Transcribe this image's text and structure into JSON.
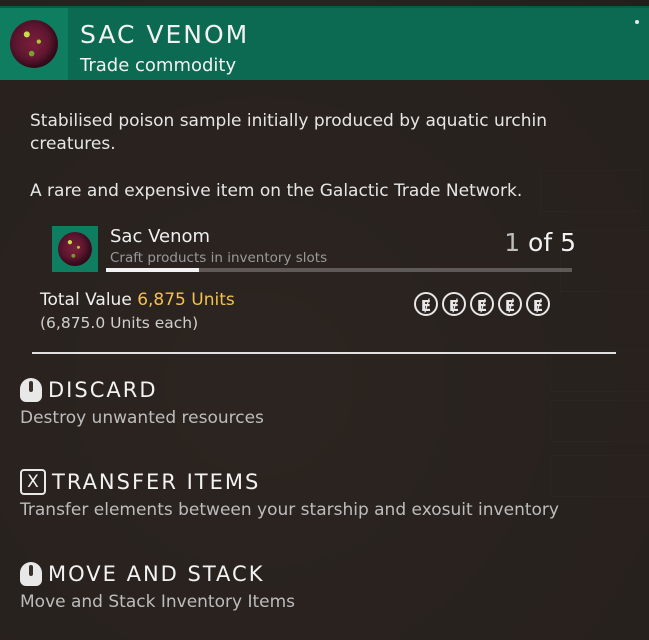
{
  "header": {
    "title": "SAC VENOM",
    "subtitle": "Trade commodity"
  },
  "description": {
    "line1": "Stabilised poison sample initially produced by aquatic urchin creatures.",
    "line2": "A rare and expensive item on the Galactic Trade Network."
  },
  "item": {
    "name": "Sac Venom",
    "hint": "Craft products in inventory slots",
    "count_current": "1",
    "count_of": " of 5",
    "progress_fraction": 0.2
  },
  "value": {
    "label": "Total Value ",
    "amount": "6,875 Units",
    "each": "(6,875.0 Units each)",
    "rarity_symbols": [
      "Ɇ",
      "Ɇ",
      "Ɇ",
      "Ɇ",
      "Ɇ"
    ]
  },
  "actions": [
    {
      "title": "DISCARD",
      "desc": "Destroy unwanted resources",
      "icon": "mouse-icon"
    },
    {
      "title": "TRANSFER ITEMS",
      "desc": "Transfer elements between your starship and exosuit inventory",
      "icon": "key-icon",
      "key": "X"
    },
    {
      "title": "MOVE AND STACK",
      "desc": "Move and Stack Inventory Items",
      "icon": "mouse-icon"
    }
  ]
}
